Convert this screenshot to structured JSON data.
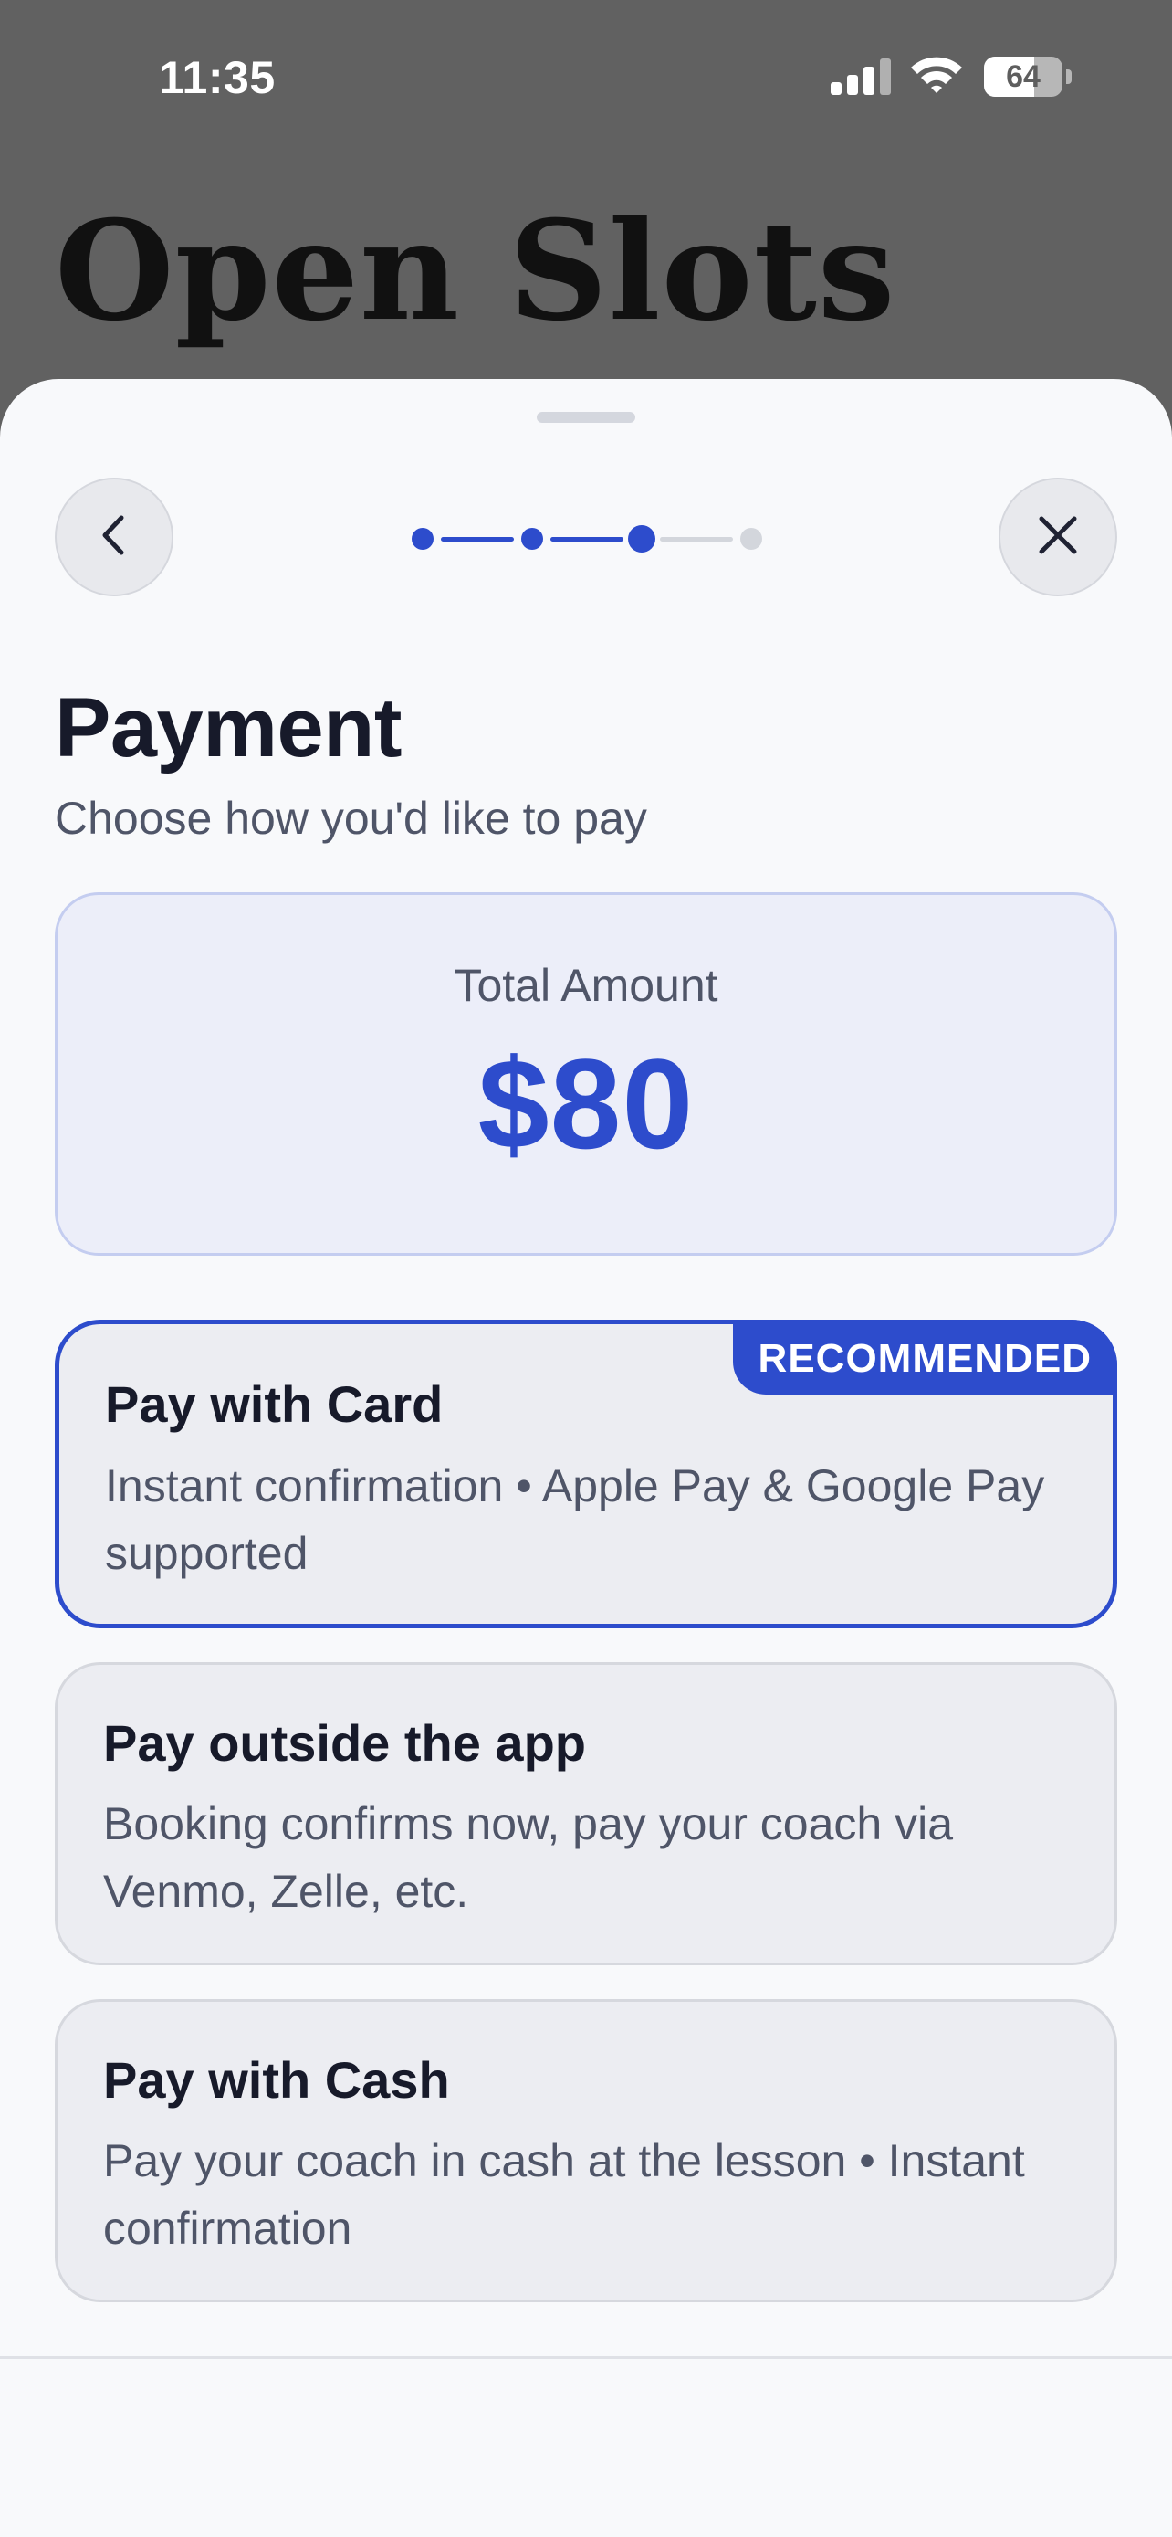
{
  "status_bar": {
    "time": "11:35",
    "battery_level": "64",
    "battery_fraction": 0.64,
    "icons": [
      "signal-icon",
      "wifi-icon",
      "battery-icon"
    ]
  },
  "background": {
    "title": "Open Slots"
  },
  "header": {
    "back_icon": "chevron-left-icon",
    "close_icon": "close-icon",
    "stepper": {
      "total_steps": 4,
      "current_step": 3
    }
  },
  "payment": {
    "title": "Payment",
    "subtitle": "Choose how you'd like to pay",
    "total_label": "Total Amount",
    "total_value": "$80",
    "options": [
      {
        "title": "Pay with Card",
        "description": "Instant confirmation • Apple Pay & Google Pay supported",
        "badge": "RECOMMENDED",
        "selected": true
      },
      {
        "title": "Pay outside the app",
        "description": "Booking confirms now, pay your coach via Venmo, Zelle, etc.",
        "selected": false
      },
      {
        "title": "Pay with Cash",
        "description": "Pay your coach in cash at the lesson • Instant confirmation",
        "selected": false
      }
    ]
  },
  "colors": {
    "accent": "#2d4ccc",
    "sheet_background": "#f8f9fb",
    "inactive_step": "#d3d6dc"
  }
}
